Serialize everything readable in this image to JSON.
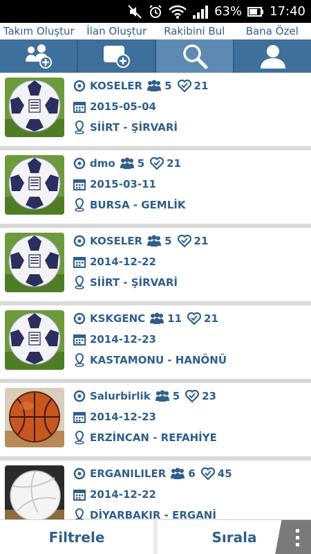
{
  "status_bar": {
    "battery": "63%",
    "time": "17:40"
  },
  "tabs": {
    "labels": [
      "Takım Oluştur",
      "İlan  Oluştur",
      "Rakibini  Bul",
      "Bana Özel"
    ],
    "icons": [
      "team-add-icon",
      "post-add-icon",
      "search-icon",
      "user-icon"
    ],
    "active_index": 2
  },
  "listings": [
    {
      "sport": "football",
      "team": "KOSELER",
      "players": "5",
      "likes": "21",
      "date": "2015-05-04",
      "location": "SİİRT - ŞİRVARİ"
    },
    {
      "sport": "football",
      "team": "dmo",
      "players": "5",
      "likes": "21",
      "date": "2015-03-11",
      "location": "BURSA - GEMLİK"
    },
    {
      "sport": "football",
      "team": "KOSELER",
      "players": "5",
      "likes": "21",
      "date": "2014-12-22",
      "location": "SİİRT - ŞİRVARİ"
    },
    {
      "sport": "football",
      "team": "KSKGENC",
      "players": "11",
      "likes": "21",
      "date": "2014-12-23",
      "location": "KASTAMONU - HANÖNÜ"
    },
    {
      "sport": "basketball",
      "team": "Salurbirlik",
      "players": "5",
      "likes": "23",
      "date": "2014-12-23",
      "location": "ERZİNCAN - REFAHİYE"
    },
    {
      "sport": "volleyball",
      "team": "ERGANILILER",
      "players": "6",
      "likes": "45",
      "date": "2014-12-22",
      "location": "DİYARBAKIR - ERGANİ"
    }
  ],
  "bottom_bar": {
    "filter_label": "Filtrele",
    "sort_label": "Sırala",
    "menu_icon": "overflow-menu-icon"
  },
  "colors": {
    "accent": "#2f5f8c",
    "tabbar": "#3f6f9b",
    "tab_active": "#5d8ab3"
  }
}
